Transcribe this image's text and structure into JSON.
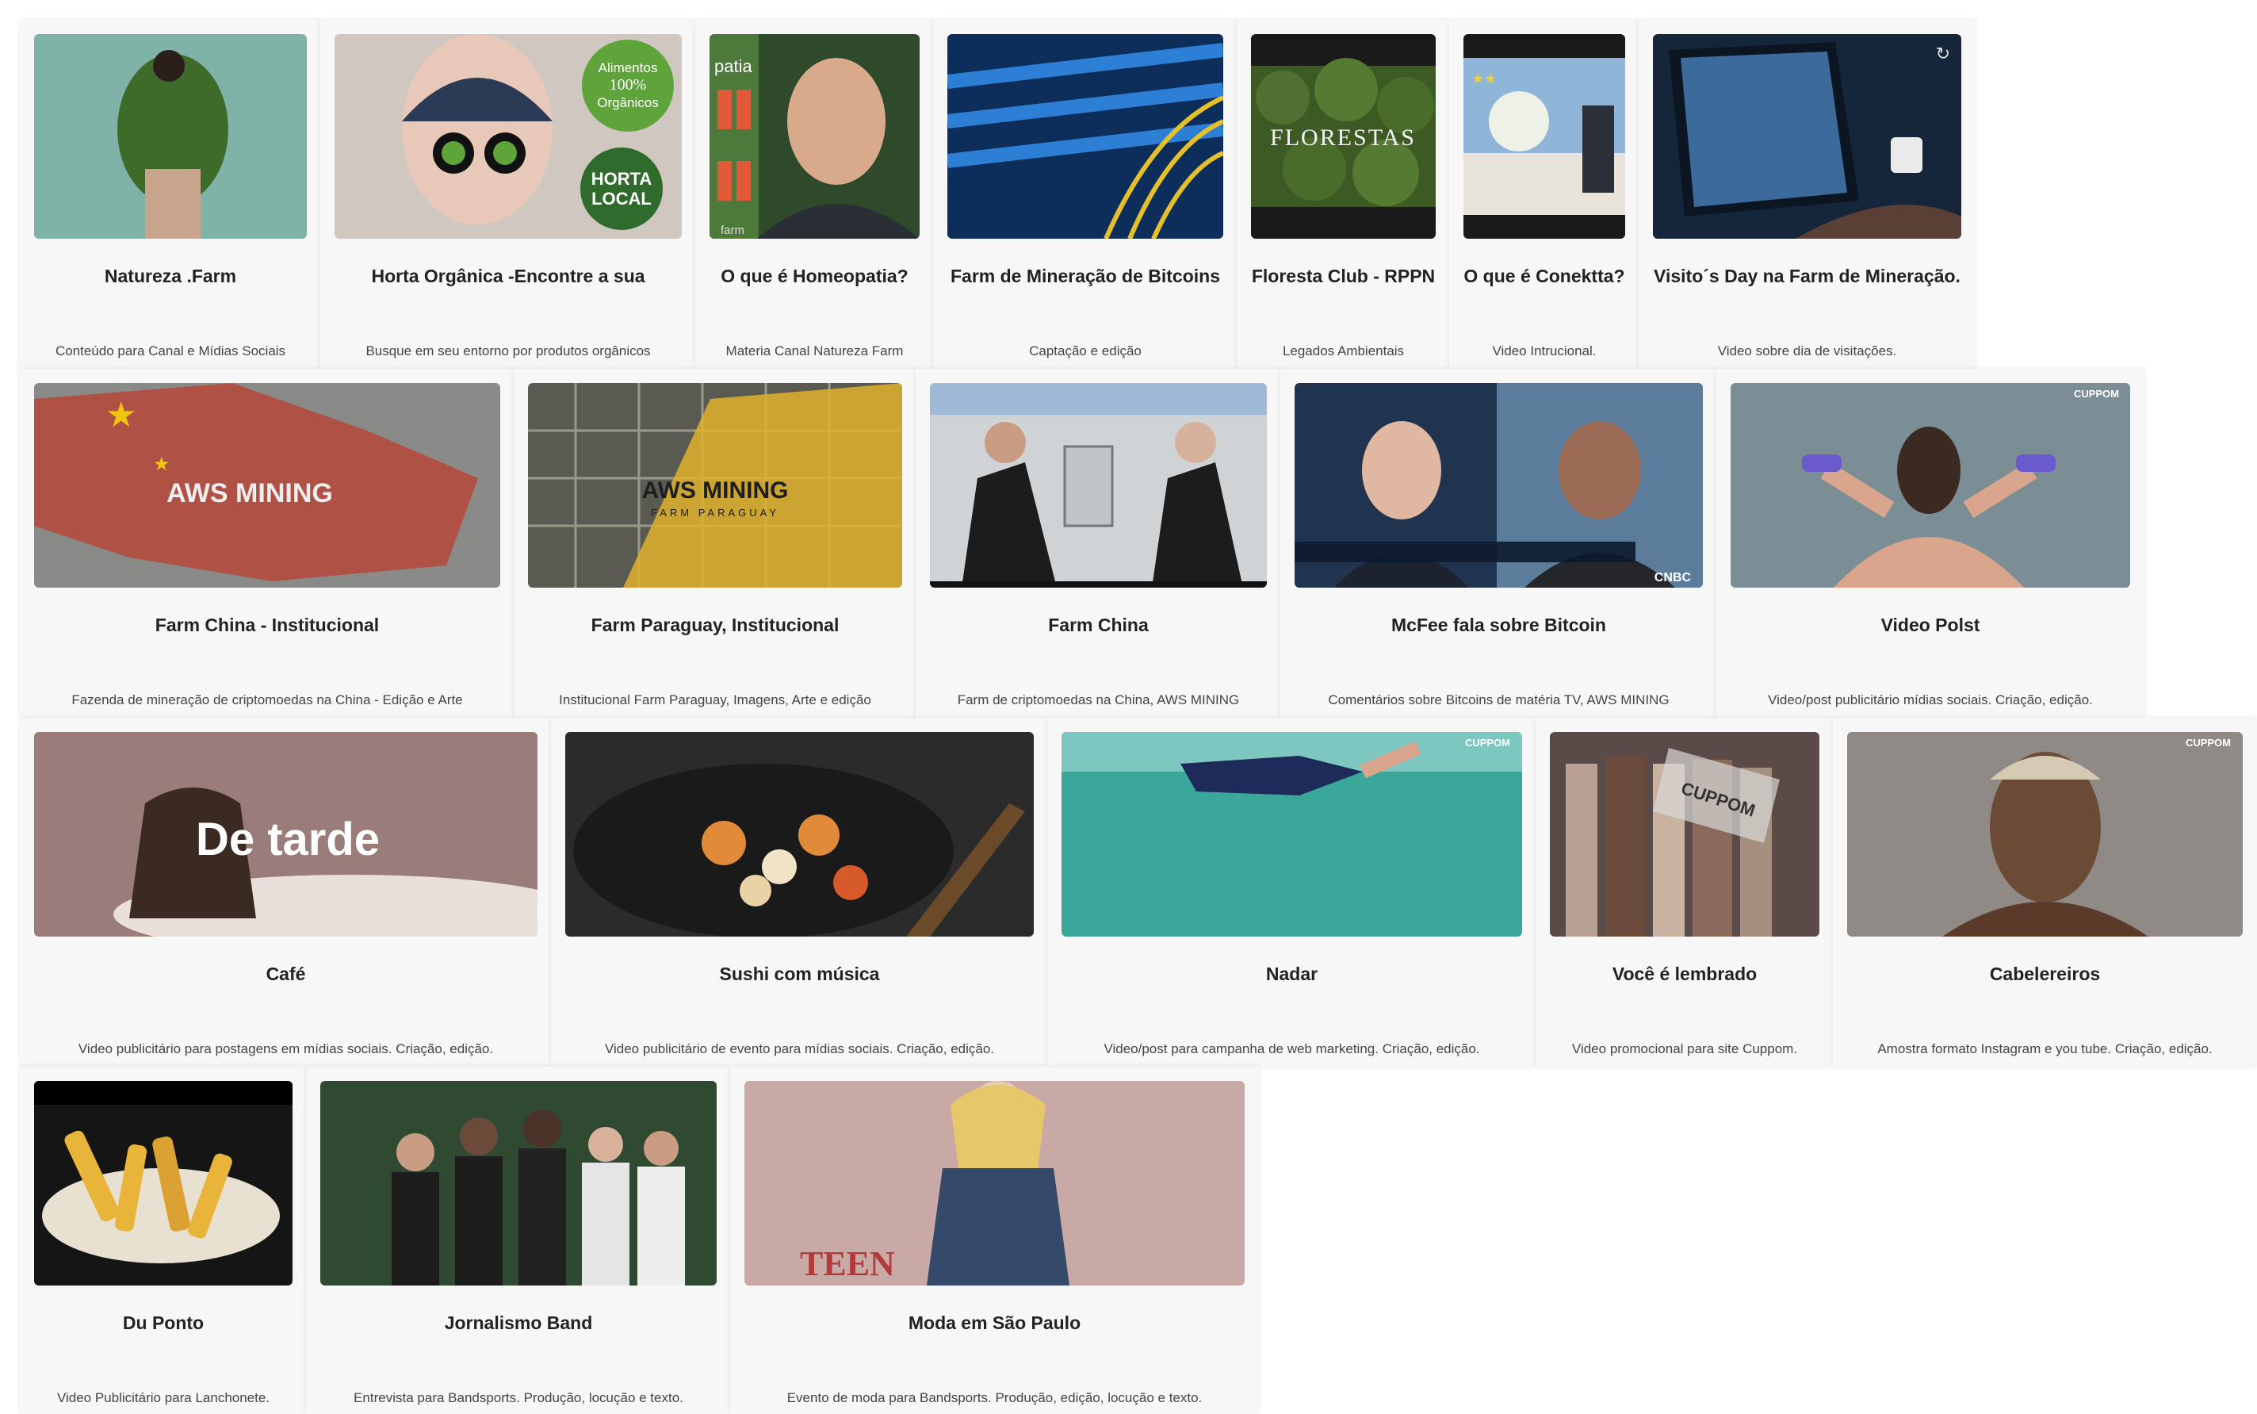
{
  "rows": [
    [
      {
        "title": "Natureza .Farm",
        "description": "Conteúdo para Canal e Mídias Sociais",
        "thumb_color": "#7fb3a8",
        "thumb_accent": "#3f6b2a"
      },
      {
        "title": "Horta Orgânica -Encontre a sua",
        "description": "Busque em seu entorno por produtos orgânicos",
        "thumb_color": "#cfc7c0",
        "thumb_accent": "#5fa43a",
        "overlay_texts": [
          "Alimentos",
          "100%",
          "Orgânicos",
          "HORTA",
          "LOCAL"
        ]
      },
      {
        "title": "O que é Homeopatia?",
        "description": "Materia Canal Natureza Farm",
        "thumb_color": "#2f4a2a",
        "thumb_accent": "#d9a98b",
        "overlay_texts": [
          "patia",
          "farm"
        ]
      },
      {
        "title": "Farm de Mineração de Bitcoins",
        "description": "Captação e edição",
        "thumb_color": "#0d2d5a",
        "thumb_accent": "#e6c02a"
      },
      {
        "title": "Floresta Club - RPPN",
        "description": "Legados Ambientais",
        "thumb_color": "#1a1a1a",
        "thumb_accent": "#3d5a25",
        "overlay_texts": [
          "FLORESTAS"
        ]
      },
      {
        "title": "O que é Conektta?",
        "description": "Video Intrucional.",
        "thumb_color": "#1a1a1a",
        "thumb_accent": "#8fb6d8"
      },
      {
        "title": "Visito´s Day na Farm de Mineração.",
        "description": "Video sobre dia de visitações.",
        "thumb_color": "#16263a",
        "thumb_accent": "#3c6a9a"
      }
    ],
    [
      {
        "title": "Farm China - Institucional",
        "description": "Fazenda de mineração de criptomoedas na China - Edição e Arte",
        "thumb_color": "#8a8a88",
        "thumb_accent": "#c0392b",
        "overlay_texts": [
          "AWS MINING"
        ]
      },
      {
        "title": "Farm Paraguay, Institucional",
        "description": "Institucional Farm Paraguay, Imagens, Arte e edição",
        "thumb_color": "#5a5a52",
        "thumb_accent": "#e1b12c",
        "overlay_texts": [
          "AWS MINING",
          "FARM PARAGUAY"
        ]
      },
      {
        "title": "Farm China",
        "description": "Farm de criptomoedas na China, AWS MINING",
        "thumb_color": "#cfd3d6",
        "thumb_accent": "#1c1c1c"
      },
      {
        "title": "McFee fala sobre Bitcoin",
        "description": "Comentários sobre Bitcoins de matéria TV, AWS MINING",
        "thumb_color": "#203450",
        "thumb_accent": "#9a6a55",
        "overlay_texts": [
          "CNBC"
        ]
      },
      {
        "title": "Video Polst",
        "description": "Video/post publicitário mídias sociais. Criação, edição.",
        "thumb_color": "#7c8e95",
        "thumb_accent": "#6a5acd",
        "overlay_texts": [
          "CUPPOM"
        ]
      }
    ],
    [
      {
        "title": "Café",
        "description": "Video publicitário para postagens em mídias sociais. Criação, edição.",
        "thumb_color": "#9a7d7a",
        "thumb_accent": "#3b2a22",
        "overlay_texts": [
          "De tarde"
        ]
      },
      {
        "title": "Sushi com música",
        "description": "Video publicitário de evento para mídias sociais. Criação, edição.",
        "thumb_color": "#2b2b2b",
        "thumb_accent": "#e08a3a"
      },
      {
        "title": "Nadar",
        "description": "Video/post para campanha de web marketing. Criação, edição.",
        "thumb_color": "#3aa79a",
        "thumb_accent": "#1e2a5a",
        "overlay_texts": [
          "CUPPOM"
        ]
      },
      {
        "title": "Você é lembrado",
        "description": "Video promocional para site Cuppom.",
        "thumb_color": "#5a4a48",
        "thumb_accent": "#b9a094",
        "overlay_texts": [
          "CUPPOM"
        ]
      },
      {
        "title": "Cabelereiros",
        "description": "Amostra formato Instagram e you tube. Criação, edição.",
        "thumb_color": "#8f8a86",
        "thumb_accent": "#6b4a36",
        "overlay_texts": [
          "CUPPOM"
        ]
      }
    ],
    [
      {
        "title": "Du Ponto",
        "description": "Video Publicitário para Lanchonete.",
        "thumb_color": "#151515",
        "thumb_accent": "#e9b43a"
      },
      {
        "title": "Jornalismo Band",
        "description": "Entrevista para Bandsports. Produção, locução e texto.",
        "thumb_color": "#2f4a30",
        "thumb_accent": "#1d1d1d"
      },
      {
        "title": "Moda em São Paulo",
        "description": "Evento de moda para Bandsports. Produção, edição, locução e texto.",
        "thumb_color": "#c9a9a6",
        "thumb_accent": "#354a6a",
        "overlay_texts": [
          "TEEN"
        ]
      }
    ]
  ]
}
